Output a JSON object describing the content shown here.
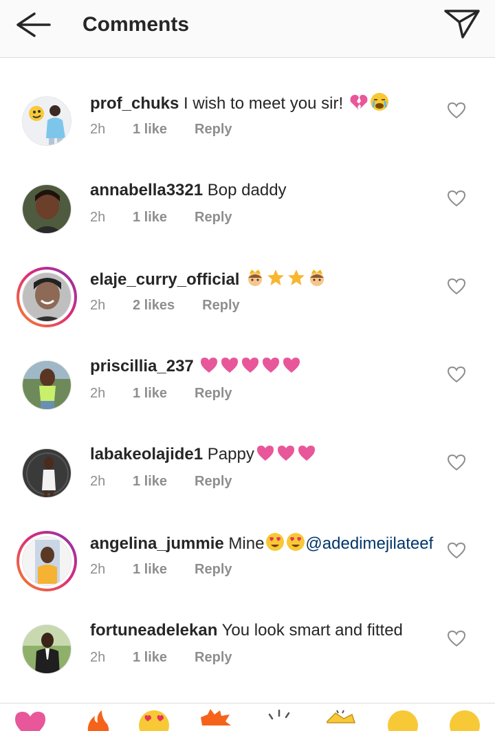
{
  "header": {
    "title": "Comments",
    "back_icon": "arrow-left-icon",
    "send_icon": "paper-plane-icon"
  },
  "comments": [
    {
      "username": "prof_chuks",
      "text": " I wish to meet you sir! ",
      "emojis": [
        "broken-heart",
        "crying-face"
      ],
      "time": "2h",
      "likes": "1 like",
      "reply": "Reply",
      "story_ring": false
    },
    {
      "username": "annabella3321",
      "text": " Bop daddy",
      "emojis": [],
      "time": "2h",
      "likes": "1 like",
      "reply": "Reply",
      "story_ring": false
    },
    {
      "username": "elaje_curry_official",
      "text": " ",
      "emojis": [
        "prince",
        "star",
        "star",
        "prince"
      ],
      "time": "2h",
      "likes": "2 likes",
      "reply": "Reply",
      "story_ring": true
    },
    {
      "username": "priscillia_237",
      "text": " ",
      "emojis": [
        "pink-heart",
        "pink-heart",
        "pink-heart",
        "pink-heart",
        "pink-heart"
      ],
      "time": "2h",
      "likes": "1 like",
      "reply": "Reply",
      "story_ring": false
    },
    {
      "username": "labakeolajide1",
      "text": " Pappy",
      "emojis": [
        "pink-heart",
        "pink-heart",
        "pink-heart"
      ],
      "time": "2h",
      "likes": "1 like",
      "reply": "Reply",
      "story_ring": false
    },
    {
      "username": "angelina_jummie",
      "text": " Mine",
      "emojis": [
        "heart-eyes",
        "heart-eyes"
      ],
      "mention": "@adedimejilateef",
      "time": "2h",
      "likes": "1 like",
      "reply": "Reply",
      "story_ring": true
    },
    {
      "username": "fortuneadelekan",
      "text": " You look smart and fitted",
      "emojis": [],
      "time": "2h",
      "likes": "1 like",
      "reply": "Reply",
      "story_ring": false
    }
  ],
  "emoji_bar": [
    "heart",
    "fire",
    "heart-eyes",
    "explosion",
    "sparkle",
    "clapping",
    "face",
    "face"
  ],
  "colors": {
    "pink_heart": "#e8579a",
    "mention": "#003569",
    "meta": "#8e8e8e",
    "ring_start": "#f58529",
    "ring_end": "#8134af"
  }
}
